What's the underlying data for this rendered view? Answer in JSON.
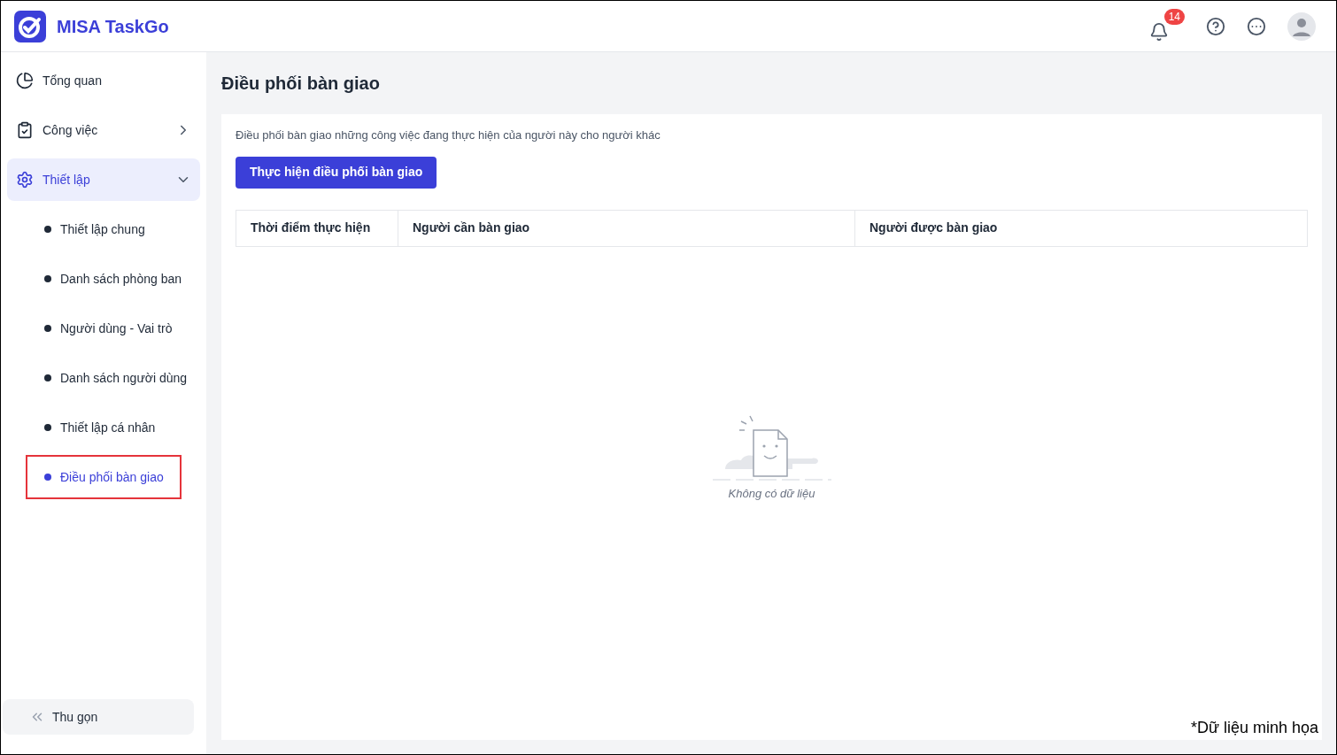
{
  "app": {
    "name": "MISA TaskGo"
  },
  "header": {
    "notification_count": "14"
  },
  "sidebar": {
    "items": [
      {
        "kind": "overview",
        "label": "Tổng quan",
        "selected": false
      },
      {
        "kind": "tasks",
        "label": "Công việc",
        "selected": false,
        "expanded": false
      },
      {
        "kind": "settings",
        "label": "Thiết lập",
        "selected": true,
        "expanded": true,
        "children": [
          {
            "label": "Thiết lập chung",
            "selected": false,
            "highlighted": false
          },
          {
            "label": "Danh sách phòng ban",
            "selected": false,
            "highlighted": false
          },
          {
            "label": "Người dùng - Vai trò",
            "selected": false,
            "highlighted": false
          },
          {
            "label": "Danh sách người dùng",
            "selected": false,
            "highlighted": false
          },
          {
            "label": "Thiết lập cá nhân",
            "selected": false,
            "highlighted": false
          },
          {
            "label": "Điều phối bàn giao",
            "selected": true,
            "highlighted": true
          }
        ]
      }
    ],
    "collapse_label": "Thu gọn"
  },
  "page": {
    "title": "Điều phối bàn giao",
    "description": "Điều phối bàn giao những công việc đang thực hiện của người này cho người khác",
    "action_button": "Thực hiện điều phối bàn giao",
    "table": {
      "columns": [
        "Thời điểm thực hiện",
        "Người cần bàn giao",
        "Người được bàn giao"
      ],
      "empty_text": "Không có dữ liệu"
    }
  },
  "footnote": "*Dữ liệu minh họa"
}
